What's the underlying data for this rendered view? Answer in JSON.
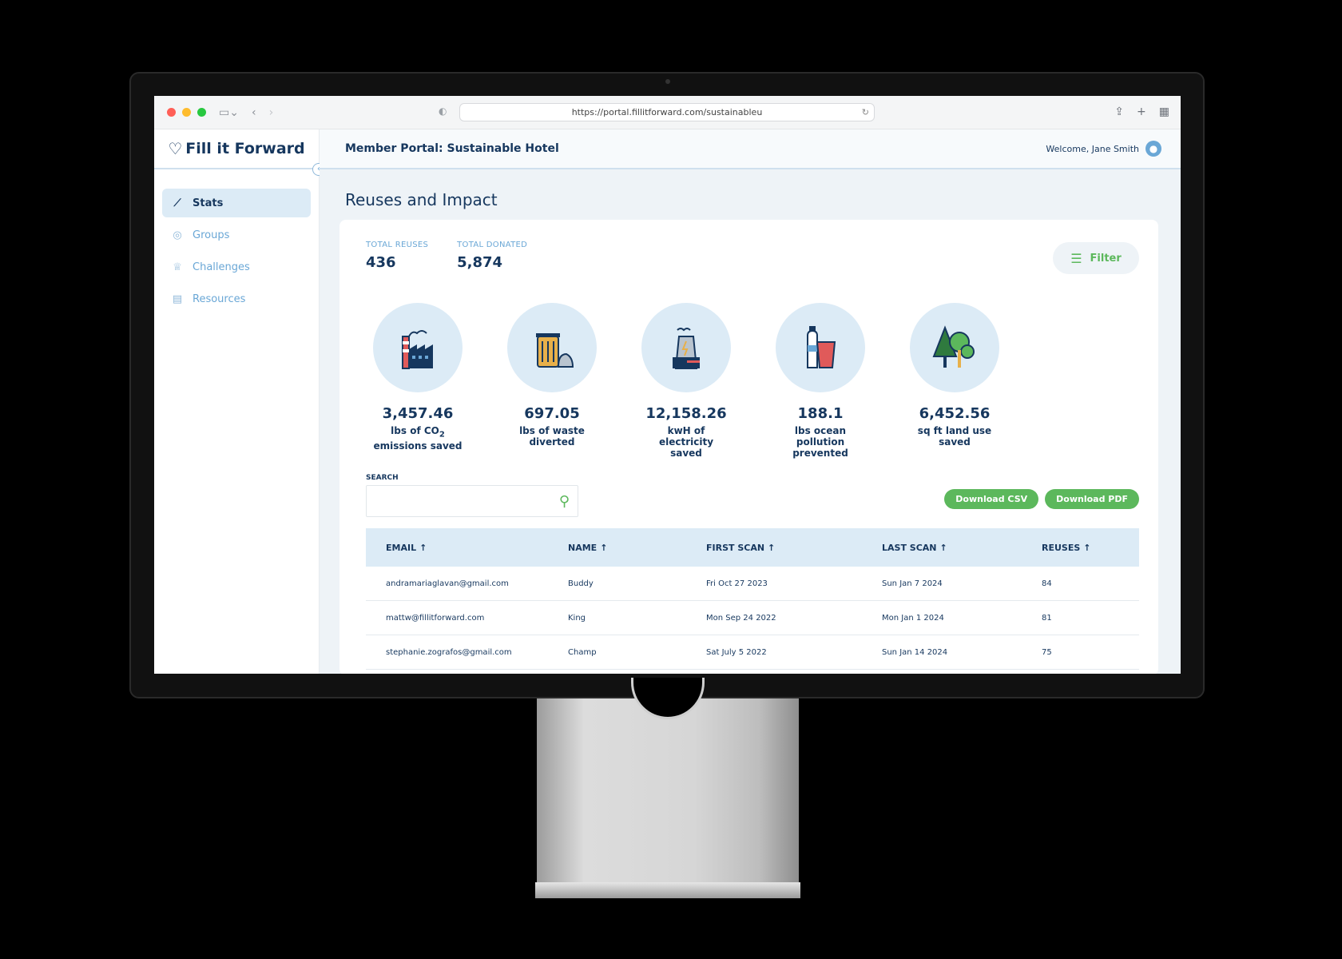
{
  "browser": {
    "url": "https://portal.fillitforward.com/sustainableu"
  },
  "sidebar": {
    "logo": "Fill it Forward",
    "items": [
      {
        "label": "Stats",
        "icon": "chart-line-icon",
        "active": true
      },
      {
        "label": "Groups",
        "icon": "groups-icon",
        "active": false
      },
      {
        "label": "Challenges",
        "icon": "trophy-icon",
        "active": false
      },
      {
        "label": "Resources",
        "icon": "document-icon",
        "active": false
      }
    ]
  },
  "header": {
    "portal_title": "Member Portal:  Sustainable Hotel",
    "welcome": "Welcome, Jane Smith"
  },
  "main": {
    "title": "Reuses and Impact",
    "totals": {
      "reuses_label": "TOTAL REUSES",
      "reuses_value": "436",
      "donated_label": "TOTAL DONATED",
      "donated_value": "5,874"
    },
    "filter_label": "Filter",
    "impacts": [
      {
        "value": "3,457.46",
        "label_line1": "lbs of CO",
        "label_sub": "2",
        "label_line2": "emissions saved",
        "icon": "factory-icon"
      },
      {
        "value": "697.05",
        "label_line1": "lbs of waste",
        "label_sub": "",
        "label_line2": "diverted",
        "icon": "trash-bin-icon"
      },
      {
        "value": "12,158.26",
        "label_line1": "kwH of electricity",
        "label_sub": "",
        "label_line2": "saved",
        "icon": "power-plant-icon"
      },
      {
        "value": "188.1",
        "label_line1": "lbs ocean pollution",
        "label_sub": "",
        "label_line2": "prevented",
        "icon": "bottle-cup-icon"
      },
      {
        "value": "6,452.56",
        "label_line1": "sq ft land use",
        "label_sub": "",
        "label_line2": "saved",
        "icon": "trees-icon"
      }
    ],
    "search": {
      "label": "SEARCH",
      "placeholder": ""
    },
    "download_csv": "Download CSV",
    "download_pdf": "Download PDF",
    "table": {
      "headers": [
        "EMAIL",
        "NAME",
        "FIRST SCAN",
        "LAST SCAN",
        "REUSES"
      ],
      "rows": [
        [
          "andramariaglavan@gmail.com",
          "Buddy",
          "Fri Oct 27 2023",
          "Sun Jan 7 2024",
          "84"
        ],
        [
          "mattw@fillitforward.com",
          "King",
          "Mon Sep 24 2022",
          "Mon Jan 1 2024",
          "81"
        ],
        [
          "stephanie.zografos@gmail.com",
          "Champ",
          "Sat July 5 2022",
          "Sun Jan 14 2024",
          "75"
        ]
      ]
    }
  },
  "colors": {
    "navy": "#16375e",
    "accent_blue": "#6aa7d6",
    "light_blue": "#dcebf6",
    "green": "#5cb85c"
  }
}
